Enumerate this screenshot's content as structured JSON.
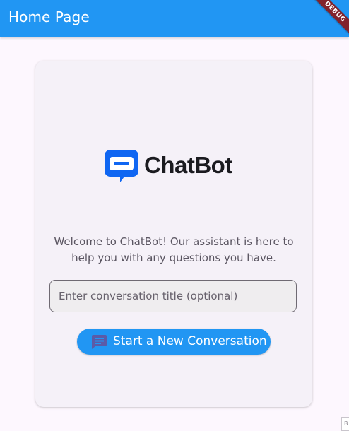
{
  "appbar": {
    "title": "Home Page",
    "debug_banner": "DEBUG",
    "color": "#2196f3"
  },
  "card": {
    "logo": {
      "icon": "chatbot-logo-icon",
      "text": "ChatBot",
      "icon_color": "#0f66f2"
    },
    "welcome_text": "Welcome to ChatBot! Our assistant is here to help you with any questions you have.",
    "title_input": {
      "value": "",
      "placeholder": "Enter conversation title (optional)"
    },
    "start_button": {
      "icon": "chat-icon",
      "label": "Start a New Conversation",
      "icon_color": "#5b5ba7"
    }
  },
  "corner_stub": {
    "text": "B"
  }
}
